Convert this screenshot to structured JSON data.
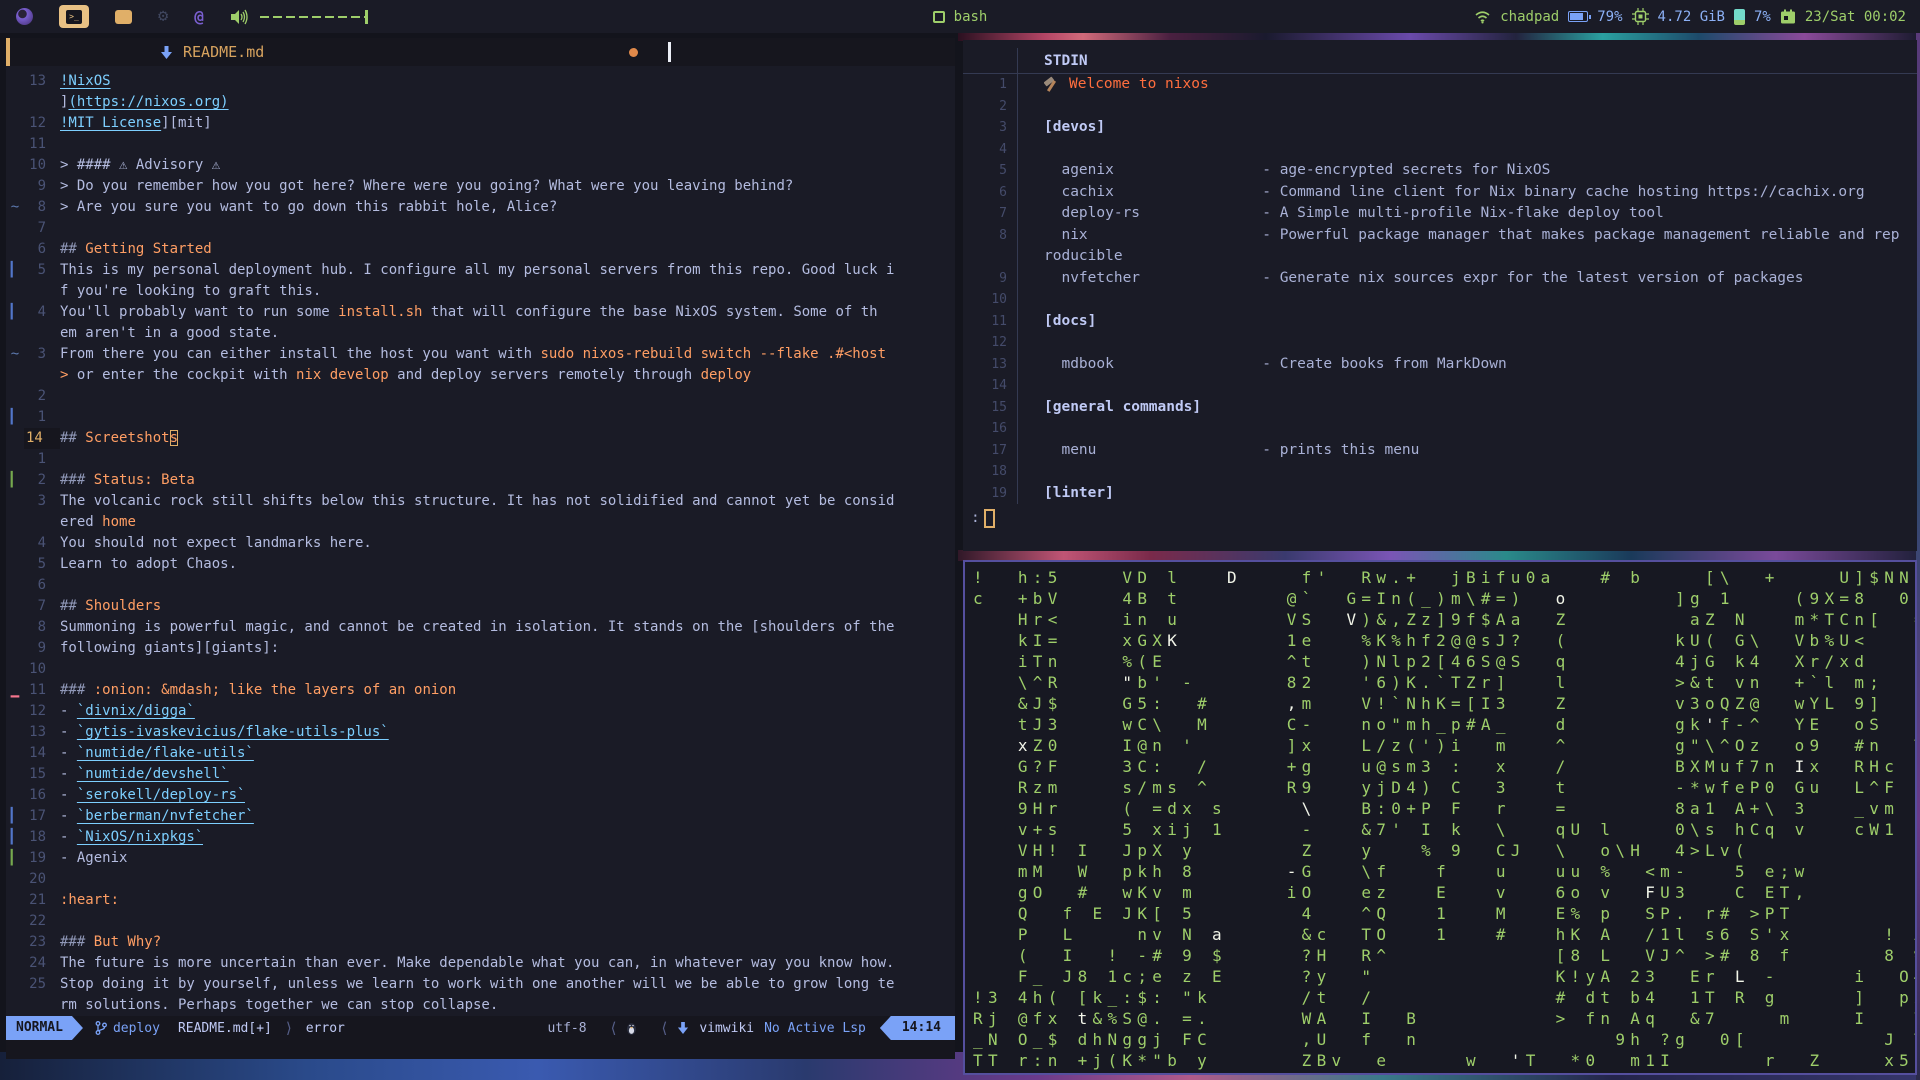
{
  "colors": {
    "bg": "#1a1b26",
    "bg_dark": "#16161e",
    "fg": "#b4bce0",
    "blue": "#7aa2f7",
    "green": "#9ece6a",
    "orange": "#ff9e64",
    "yellow": "#e0af68",
    "cyan": "#7dcfff",
    "red": "#f7768e",
    "matrix_green": "#9ece6a"
  },
  "topbar": {
    "title": "bash",
    "net": "chadpad",
    "battery": "79%",
    "mem": "4.72 GiB",
    "cpu": "7%",
    "clock": "23/Sat 00:02"
  },
  "editor": {
    "tab": {
      "file": "README.md"
    },
    "lines": [
      {
        "n": "13",
        "segs": [
          [
            "l",
            "!NixOS"
          ]
        ]
      },
      {
        "n": "",
        "segs": [
          [
            "t",
            "]"
          ],
          [
            "l",
            "(https://nixos.org)"
          ]
        ]
      },
      {
        "n": "12",
        "segs": [
          [
            "l",
            "!MIT License"
          ],
          [
            "t",
            "][mit]"
          ]
        ]
      },
      {
        "n": "11",
        "segs": []
      },
      {
        "n": "10",
        "segs": [
          [
            "t",
            "> #### ⚠ Advisory ⚠"
          ]
        ]
      },
      {
        "n": "9",
        "segs": [
          [
            "t",
            "> Do you remember how you got here? Where were you going? What were you leaving behind?"
          ]
        ]
      },
      {
        "n": "8",
        "s": "~",
        "segs": [
          [
            "t",
            "> Are you sure you want to go down this rabbit hole, Alice?"
          ]
        ]
      },
      {
        "n": "7",
        "segs": []
      },
      {
        "n": "6",
        "segs": [
          [
            "g",
            "## "
          ],
          [
            "h",
            "Getting Started"
          ]
        ]
      },
      {
        "n": "5",
        "s": "b",
        "segs": [
          [
            "t",
            "This is my personal deployment hub. I configure all my personal servers from this repo. Good luck i"
          ]
        ]
      },
      {
        "n": "",
        "segs": [
          [
            "t",
            "f you're looking to graft this."
          ]
        ]
      },
      {
        "n": "4",
        "s": "b",
        "segs": [
          [
            "t",
            "You'll probably want to run some "
          ],
          [
            "c",
            "install.sh"
          ],
          [
            "t",
            " that will configure the base NixOS system. Some of th"
          ]
        ]
      },
      {
        "n": "",
        "segs": [
          [
            "t",
            "em aren't in a good state."
          ]
        ]
      },
      {
        "n": "3",
        "s": "~",
        "segs": [
          [
            "t",
            "From there you can either install the host you want with "
          ],
          [
            "c",
            "sudo nixos-rebuild switch --flake .#<host"
          ]
        ]
      },
      {
        "n": "",
        "segs": [
          [
            "c",
            ">"
          ],
          [
            "t",
            " or enter the cockpit with "
          ],
          [
            "c",
            "nix develop"
          ],
          [
            "t",
            " and deploy servers remotely through "
          ],
          [
            "c",
            "deploy"
          ]
        ]
      },
      {
        "n": "2",
        "segs": []
      },
      {
        "n": "1",
        "s": "b",
        "segs": []
      },
      {
        "n": "14",
        "cur": true,
        "segs": [
          [
            "g",
            "## "
          ],
          [
            "h",
            "Screetshot"
          ],
          [
            "k",
            "s"
          ]
        ]
      },
      {
        "n": "1",
        "segs": []
      },
      {
        "n": "2",
        "s": "g",
        "segs": [
          [
            "g",
            "### "
          ],
          [
            "h",
            "Status: Beta"
          ]
        ]
      },
      {
        "n": "3",
        "segs": [
          [
            "t",
            "The volcanic rock still shifts below this structure. It has not solidified and cannot yet be consid"
          ]
        ]
      },
      {
        "n": "",
        "segs": [
          [
            "t",
            "ered "
          ],
          [
            "c",
            "home"
          ]
        ]
      },
      {
        "n": "4",
        "segs": [
          [
            "t",
            "You should not expect landmarks here."
          ]
        ]
      },
      {
        "n": "5",
        "segs": [
          [
            "t",
            "Learn to adopt Chaos."
          ]
        ]
      },
      {
        "n": "6",
        "segs": []
      },
      {
        "n": "7",
        "segs": [
          [
            "g",
            "## "
          ],
          [
            "h",
            "Shoulders"
          ]
        ]
      },
      {
        "n": "8",
        "segs": [
          [
            "t",
            "Summoning is powerful magic, and cannot be created in isolation. It stands on the [shoulders of the"
          ]
        ]
      },
      {
        "n": "9",
        "segs": [
          [
            "t",
            "following giants][giants]:"
          ]
        ]
      },
      {
        "n": "10",
        "segs": []
      },
      {
        "n": "11",
        "s": "r",
        "segs": [
          [
            "g",
            "### "
          ],
          [
            "h",
            ":onion: &mdash; like the layers of an onion"
          ]
        ]
      },
      {
        "n": "12",
        "segs": [
          [
            "t",
            "- "
          ],
          [
            "l",
            "`divnix/digga`"
          ]
        ]
      },
      {
        "n": "13",
        "segs": [
          [
            "t",
            "- "
          ],
          [
            "l",
            "`gytis-ivaskevicius/flake-utils-plus`"
          ]
        ]
      },
      {
        "n": "14",
        "segs": [
          [
            "t",
            "- "
          ],
          [
            "l",
            "`numtide/flake-utils`"
          ]
        ]
      },
      {
        "n": "15",
        "segs": [
          [
            "t",
            "- "
          ],
          [
            "l",
            "`numtide/devshell`"
          ]
        ]
      },
      {
        "n": "16",
        "segs": [
          [
            "t",
            "- "
          ],
          [
            "l",
            "`serokell/deploy-rs`"
          ]
        ]
      },
      {
        "n": "17",
        "s": "b",
        "segs": [
          [
            "t",
            "- "
          ],
          [
            "l",
            "`berberman/nvfetcher`"
          ]
        ]
      },
      {
        "n": "18",
        "s": "b",
        "segs": [
          [
            "t",
            "- "
          ],
          [
            "l",
            "`NixOS/nixpkgs`"
          ]
        ]
      },
      {
        "n": "19",
        "s": "g",
        "segs": [
          [
            "t",
            "- Agenix"
          ]
        ]
      },
      {
        "n": "20",
        "segs": []
      },
      {
        "n": "21",
        "segs": [
          [
            "h",
            ":heart:"
          ]
        ]
      },
      {
        "n": "22",
        "segs": []
      },
      {
        "n": "23",
        "segs": [
          [
            "g",
            "### "
          ],
          [
            "h",
            "But Why?"
          ]
        ]
      },
      {
        "n": "24",
        "segs": [
          [
            "t",
            "The future is more uncertain than ever. Make dependable what you can, in whatever way you know how."
          ]
        ]
      },
      {
        "n": "25",
        "segs": [
          [
            "t",
            "Stop doing it by yourself, unless we learn to work with one another will we be able to grow long te"
          ]
        ]
      },
      {
        "n": "",
        "segs": [
          [
            "t",
            "rm solutions. Perhaps together we can stop collapse."
          ]
        ]
      }
    ],
    "statusline": {
      "mode": "NORMAL",
      "branch": "deploy",
      "file": "README.md[+]",
      "sep_r": "⟩",
      "sep_l": "⟨",
      "diagnostic": "error",
      "encoding": "utf-8",
      "filetype": "vimwiki",
      "lsp": "No Active Lsp",
      "position": "14:14"
    }
  },
  "pager": {
    "title": "STDIN",
    "prompt": ":",
    "lines": [
      {
        "n": "1",
        "cls": "welcome",
        "t": "Welcome to nixos"
      },
      {
        "n": "2",
        "t": ""
      },
      {
        "n": "3",
        "cls": "section",
        "t": "[devos]"
      },
      {
        "n": "4",
        "t": ""
      },
      {
        "n": "5",
        "t": "  agenix                 - age-encrypted secrets for NixOS"
      },
      {
        "n": "6",
        "t": "  cachix                 - Command line client for Nix binary cache hosting https://cachix.org"
      },
      {
        "n": "7",
        "t": "  deploy-rs              - A Simple multi-profile Nix-flake deploy tool"
      },
      {
        "n": "8",
        "t": "  nix                    - Powerful package manager that makes package management reliable and rep"
      },
      {
        "n": "",
        "t": "roducible"
      },
      {
        "n": "9",
        "t": "  nvfetcher              - Generate nix sources expr for the latest version of packages"
      },
      {
        "n": "10",
        "t": ""
      },
      {
        "n": "11",
        "cls": "section",
        "t": "[docs]"
      },
      {
        "n": "12",
        "t": ""
      },
      {
        "n": "13",
        "t": "  mdbook                 - Create books from MarkDown"
      },
      {
        "n": "14",
        "t": ""
      },
      {
        "n": "15",
        "cls": "section",
        "t": "[general commands]"
      },
      {
        "n": "16",
        "t": ""
      },
      {
        "n": "17",
        "t": "  menu                   - prints this menu"
      },
      {
        "n": "18",
        "t": ""
      },
      {
        "n": "19",
        "cls": "section",
        "t": "[linter]"
      }
    ]
  },
  "matrix": {
    "rows": [
      "!  h:5    VD l   D    f'  Rw.+  jBifu0a   # b    [\\  +    U]$NN",
      "c  +bV    4B t       @`  G=In(_)m\\#=)  o       ]g 1    (9X=8  0",
      "   Hr<    in u       VS  V)&,Zz]9f$Aa  Z        aZ N   m*TCn[  =",
      "   kI=    xGXK       1e   %K%hf2@@sJ?  (       kU( G\\  Vb%U<   U",
      "   iTn    %(E        ^t   )Nlp2[46S@S  q       4jG k4  Xr/xd   :",
      "   \\^R    \"b' -      82   '6)K.`TZr]   l       >&t vn  +`l m;  N",
      "   &J$    G5:  #     ,m   V!`NhK=[I3   Z       v3oQZ@  wYL 9]  2",
      "   tJ3    wC\\  M     C-   no\"mh_p#A_   d       gk'f-^  YE  oS  E",
      "   xZ0    I@n '      ]x   L/z(')i  m   ^       g\"\\^Oz  o9  #n  T",
      "   G?F    3C:  /     +g   u@sm3 :  x   /       BXMuf7n Ix  RHc  ",
      "   Rzm    s/ms ^     R9   yjD4) C  3   t       -*wfeP0 Gu  L^F  ",
      "   9Hr    ( =dx s     \\   B:0+P F  r   =       8a1 A+\\ 3   _vm  ",
      "   v+s    5 xij 1     -   &7' I k  \\   qU l    0\\s hCq v   cW1  ",
      "   VH! I  JpX y       Z   y   % 9  CJ  \\  o\\H  4>Lv(           (",
      "   mM  W  pkh 8      -G   \\f   f   u   uu %  <m-   5 e;w       2",
      "   gO  #  wKv m      iO   ez   E   v   6o v  FU3   C ET,       9",
      "   Q  f E JK[ 5       4   ^Q   1   M   E% p  SP. r# >PT        Z",
      "   P  L    nv N a     &c  TO   1   #   hK A  /1l s6 S'x      ! A",
      "   (  I  ! -# 9 $     ?H  R^           [8 L  VJ^ ># 8 f      8 %",
      "   F_ J8 1c;e z E     ?y  \"            K!yA 23  Er L -     i  O#",
      "!3 4h( [k_:$: \"k      /t  /            # dt b4  1T R g     ]  px",
      "Rj @fx t&%S@. =.      WA  I  B         > fn Aq  &7    m    I   V",
      "_N O_$ dhNggj FC      ,U  f  n             9h ?g  0[         J T",
      "TT r:n +j(K*\"b y      ZBv  e     w  'T  *0  m1I      r  Z    x5 "
    ],
    "bright": [
      [
        0,
        17
      ],
      [
        1,
        39
      ],
      [
        2,
        25
      ],
      [
        3,
        13
      ],
      [
        5,
        10
      ],
      [
        6,
        21
      ],
      [
        7,
        49
      ],
      [
        8,
        3
      ],
      [
        9,
        55
      ],
      [
        11,
        22
      ],
      [
        12,
        45
      ],
      [
        14,
        21
      ],
      [
        15,
        45
      ],
      [
        17,
        16
      ],
      [
        19,
        51
      ],
      [
        21,
        7
      ],
      [
        22,
        13
      ],
      [
        23,
        36
      ]
    ]
  }
}
